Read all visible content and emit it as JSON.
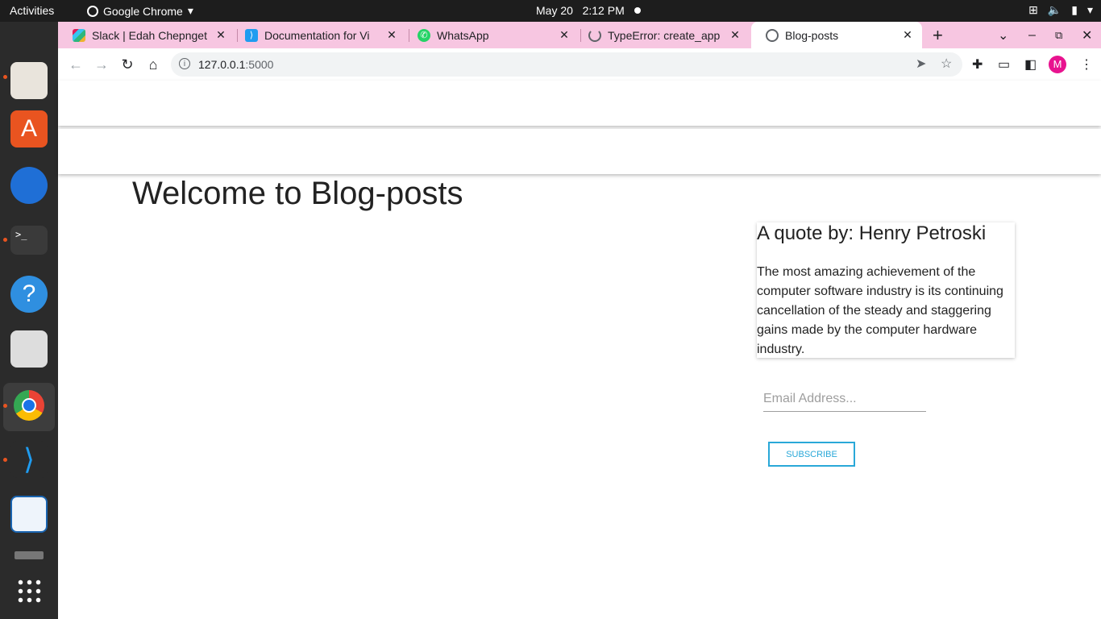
{
  "system_bar": {
    "activities": "Activities",
    "app_name": "Google Chrome",
    "date": "May 20",
    "time": "2:12 PM"
  },
  "tabs": [
    {
      "title": "Slack | Edah Chepnget",
      "active": false
    },
    {
      "title": "Documentation for Vi",
      "active": false
    },
    {
      "title": "WhatsApp",
      "active": false
    },
    {
      "title": "TypeError: create_app",
      "active": false
    },
    {
      "title": "Blog-posts",
      "active": true
    }
  ],
  "address_bar": {
    "host": "127.0.0.1",
    "port": ":5000"
  },
  "profile_initial": "M",
  "page": {
    "heading": "Welcome to Blog-posts",
    "quote_title": "A quote by: Henry Petroski",
    "quote_text": "The most amazing achievement of the computer software industry is its continuing cancellation of the steady and staggering gains made by the computer hardware industry.",
    "email_placeholder": "Email Address...",
    "subscribe_label": "SUBSCRIBE"
  },
  "colors": {
    "tab_strip": "#f7c6e1",
    "subscribe_accent": "#29a8d8",
    "avatar": "#e8138f"
  }
}
